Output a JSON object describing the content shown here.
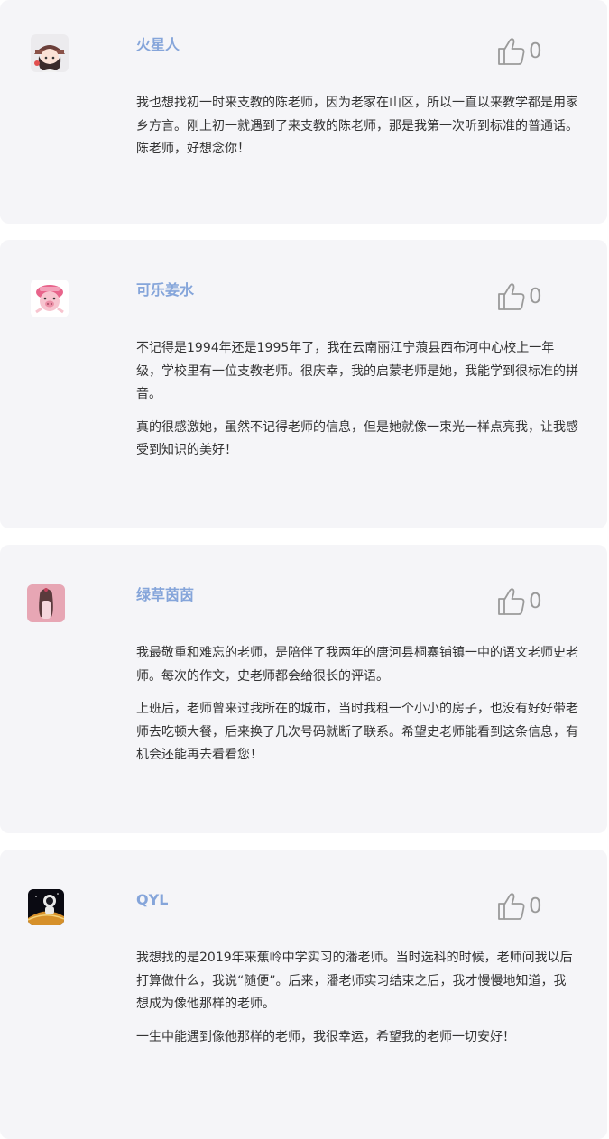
{
  "comments": [
    {
      "avatar": "girl-hat-avatar",
      "name": "火星人",
      "likes": "0",
      "paragraphs": [
        "我也想找初一时来支教的陈老师，因为老家在山区，所以一直以来教学都是用家乡方言。刚上初一就遇到了来支教的陈老师，那是我第一次听到标准的普通话。陈老师，好想念你！"
      ]
    },
    {
      "avatar": "pink-pig-avatar",
      "name": "可乐姜水",
      "likes": "0",
      "paragraphs": [
        "不记得是1994年还是1995年了，我在云南丽江宁蒗县西布河中心校上一年级，学校里有一位支教老师。很庆幸，我的启蒙老师是她，我能学到很标准的拼音。",
        "真的很感激她，虽然不记得老师的信息，但是她就像一束光一样点亮我，让我感受到知识的美好！"
      ]
    },
    {
      "avatar": "girl-long-hair-avatar",
      "name": "绿草茵茵",
      "likes": "0",
      "paragraphs": [
        "我最敬重和难忘的老师，是陪伴了我两年的唐河县桐寨铺镇一中的语文老师史老师。每次的作文，史老师都会给很长的评语。",
        "上班后，老师曾来过我所在的城市，当时我租一个小小的房子，也没有好好带老师去吃顿大餐，后来换了几次号码就断了联系。希望史老师能看到这条信息，有机会还能再去看看您！"
      ]
    },
    {
      "avatar": "astronaut-avatar",
      "name": "QYL",
      "likes": "0",
      "paragraphs": [
        "我想找的是2019年来蕉岭中学实习的潘老师。当时选科的时候，老师问我以后打算做什么，我说“随便”。后来，潘老师实习结束之后，我才慢慢地知道，我想成为像他那样的老师。",
        "一生中能遇到像他那样的老师，我很幸运，希望我的老师一切安好！"
      ]
    }
  ],
  "icons": {
    "like": "thumbs-up-icon"
  },
  "colors": {
    "card_bg": "#f5f5f8",
    "name": "#85a5da",
    "text": "#333333",
    "like": "#9a9a9a"
  }
}
